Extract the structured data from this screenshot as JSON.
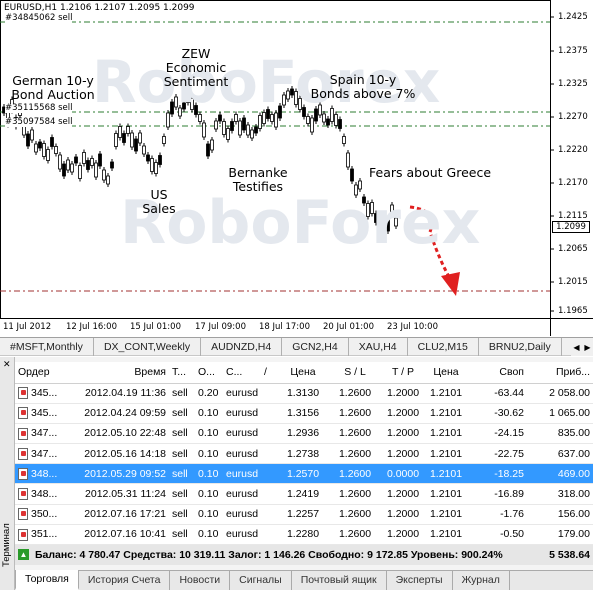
{
  "chart": {
    "symbol_title": "EURUSD,H1  1.2106 1.2107 1.2095 1.2099",
    "order_labels": [
      "#34845062 sell",
      "#35115568 sell",
      "#35097584 sell"
    ],
    "current_price": "1.2099",
    "price_ticks": [
      "1.2425",
      "1.2375",
      "1.2325",
      "1.2270",
      "1.2220",
      "1.2170",
      "1.2115",
      "1.2065",
      "1.2015",
      "1.1965"
    ],
    "time_ticks": [
      "11 Jul 2012",
      "12 Jul 16:00",
      "15 Jul 01:00",
      "17 Jul 09:00",
      "18 Jul 17:00",
      "20 Jul 01:00",
      "23 Jul 10:00"
    ],
    "annotations": [
      {
        "text": "German 10-y\nBond Auction"
      },
      {
        "text": "ZEW\nEconomic\nSentiment"
      },
      {
        "text": "US\nSales"
      },
      {
        "text": "Bernanke\nTestifies"
      },
      {
        "text": "Spain 10-y\nBonds above 7%"
      },
      {
        "text": "Fears about Greece"
      }
    ],
    "watermark": "RoboForex",
    "colors": {
      "bull": "#000000",
      "bear": "#000000",
      "levels": "#2e7d32",
      "arrow": "#e02020"
    }
  },
  "symbol_tabs": [
    "#MSFT,Monthly",
    "DX_CONT,Weekly",
    "AUDNZD,H4",
    "GCN2,H4",
    "XAU,H4",
    "CLU2,M15",
    "BRNU2,Daily"
  ],
  "terminal": {
    "side_title": "Терминал",
    "columns": [
      "Ордер",
      "Время",
      "Т...",
      "О...",
      "С...",
      "/",
      "Цена",
      "S / L",
      "T / P",
      "Цена",
      "Своп",
      "Приб..."
    ],
    "rows": [
      [
        "345...",
        "2012.04.19 11:36",
        "sell",
        "0.20",
        "eurusd",
        "1.3130",
        "1.2600",
        "1.2000",
        "1.2101",
        "-63.44",
        "2 058.00"
      ],
      [
        "345...",
        "2012.04.24 09:59",
        "sell",
        "0.10",
        "eurusd",
        "1.3156",
        "1.2600",
        "1.2000",
        "1.2101",
        "-30.62",
        "1 065.00"
      ],
      [
        "347...",
        "2012.05.10 22:48",
        "sell",
        "0.10",
        "eurusd",
        "1.2936",
        "1.2600",
        "1.2000",
        "1.2101",
        "-24.15",
        "835.00"
      ],
      [
        "347...",
        "2012.05.16 14:18",
        "sell",
        "0.10",
        "eurusd",
        "1.2738",
        "1.2600",
        "1.2000",
        "1.2101",
        "-22.75",
        "637.00"
      ],
      [
        "348...",
        "2012.05.29 09:52",
        "sell",
        "0.10",
        "eurusd",
        "1.2570",
        "1.2600",
        "0.0000",
        "1.2101",
        "-18.25",
        "469.00"
      ],
      [
        "348...",
        "2012.05.31 11:24",
        "sell",
        "0.10",
        "eurusd",
        "1.2419",
        "1.2600",
        "1.2000",
        "1.2101",
        "-16.89",
        "318.00"
      ],
      [
        "350...",
        "2012.07.16 17:21",
        "sell",
        "0.10",
        "eurusd",
        "1.2257",
        "1.2600",
        "1.2000",
        "1.2101",
        "-1.76",
        "156.00"
      ],
      [
        "351...",
        "2012.07.16 10:41",
        "sell",
        "0.10",
        "eurusd",
        "1.2280",
        "1.2600",
        "1.2000",
        "1.2101",
        "-0.50",
        "179.00"
      ]
    ],
    "selected_row": 4,
    "balance_line": "Баланс: 4 780.47  Средства: 10 319.11  Залог: 1 146.26  Свободно: 9 172.85  Уровень: 900.24%",
    "balance_total": "5 538.64",
    "bottom_tabs": [
      "Торговля",
      "История Счета",
      "Новости",
      "Сигналы",
      "Почтовый ящик",
      "Эксперты",
      "Журнал"
    ]
  }
}
